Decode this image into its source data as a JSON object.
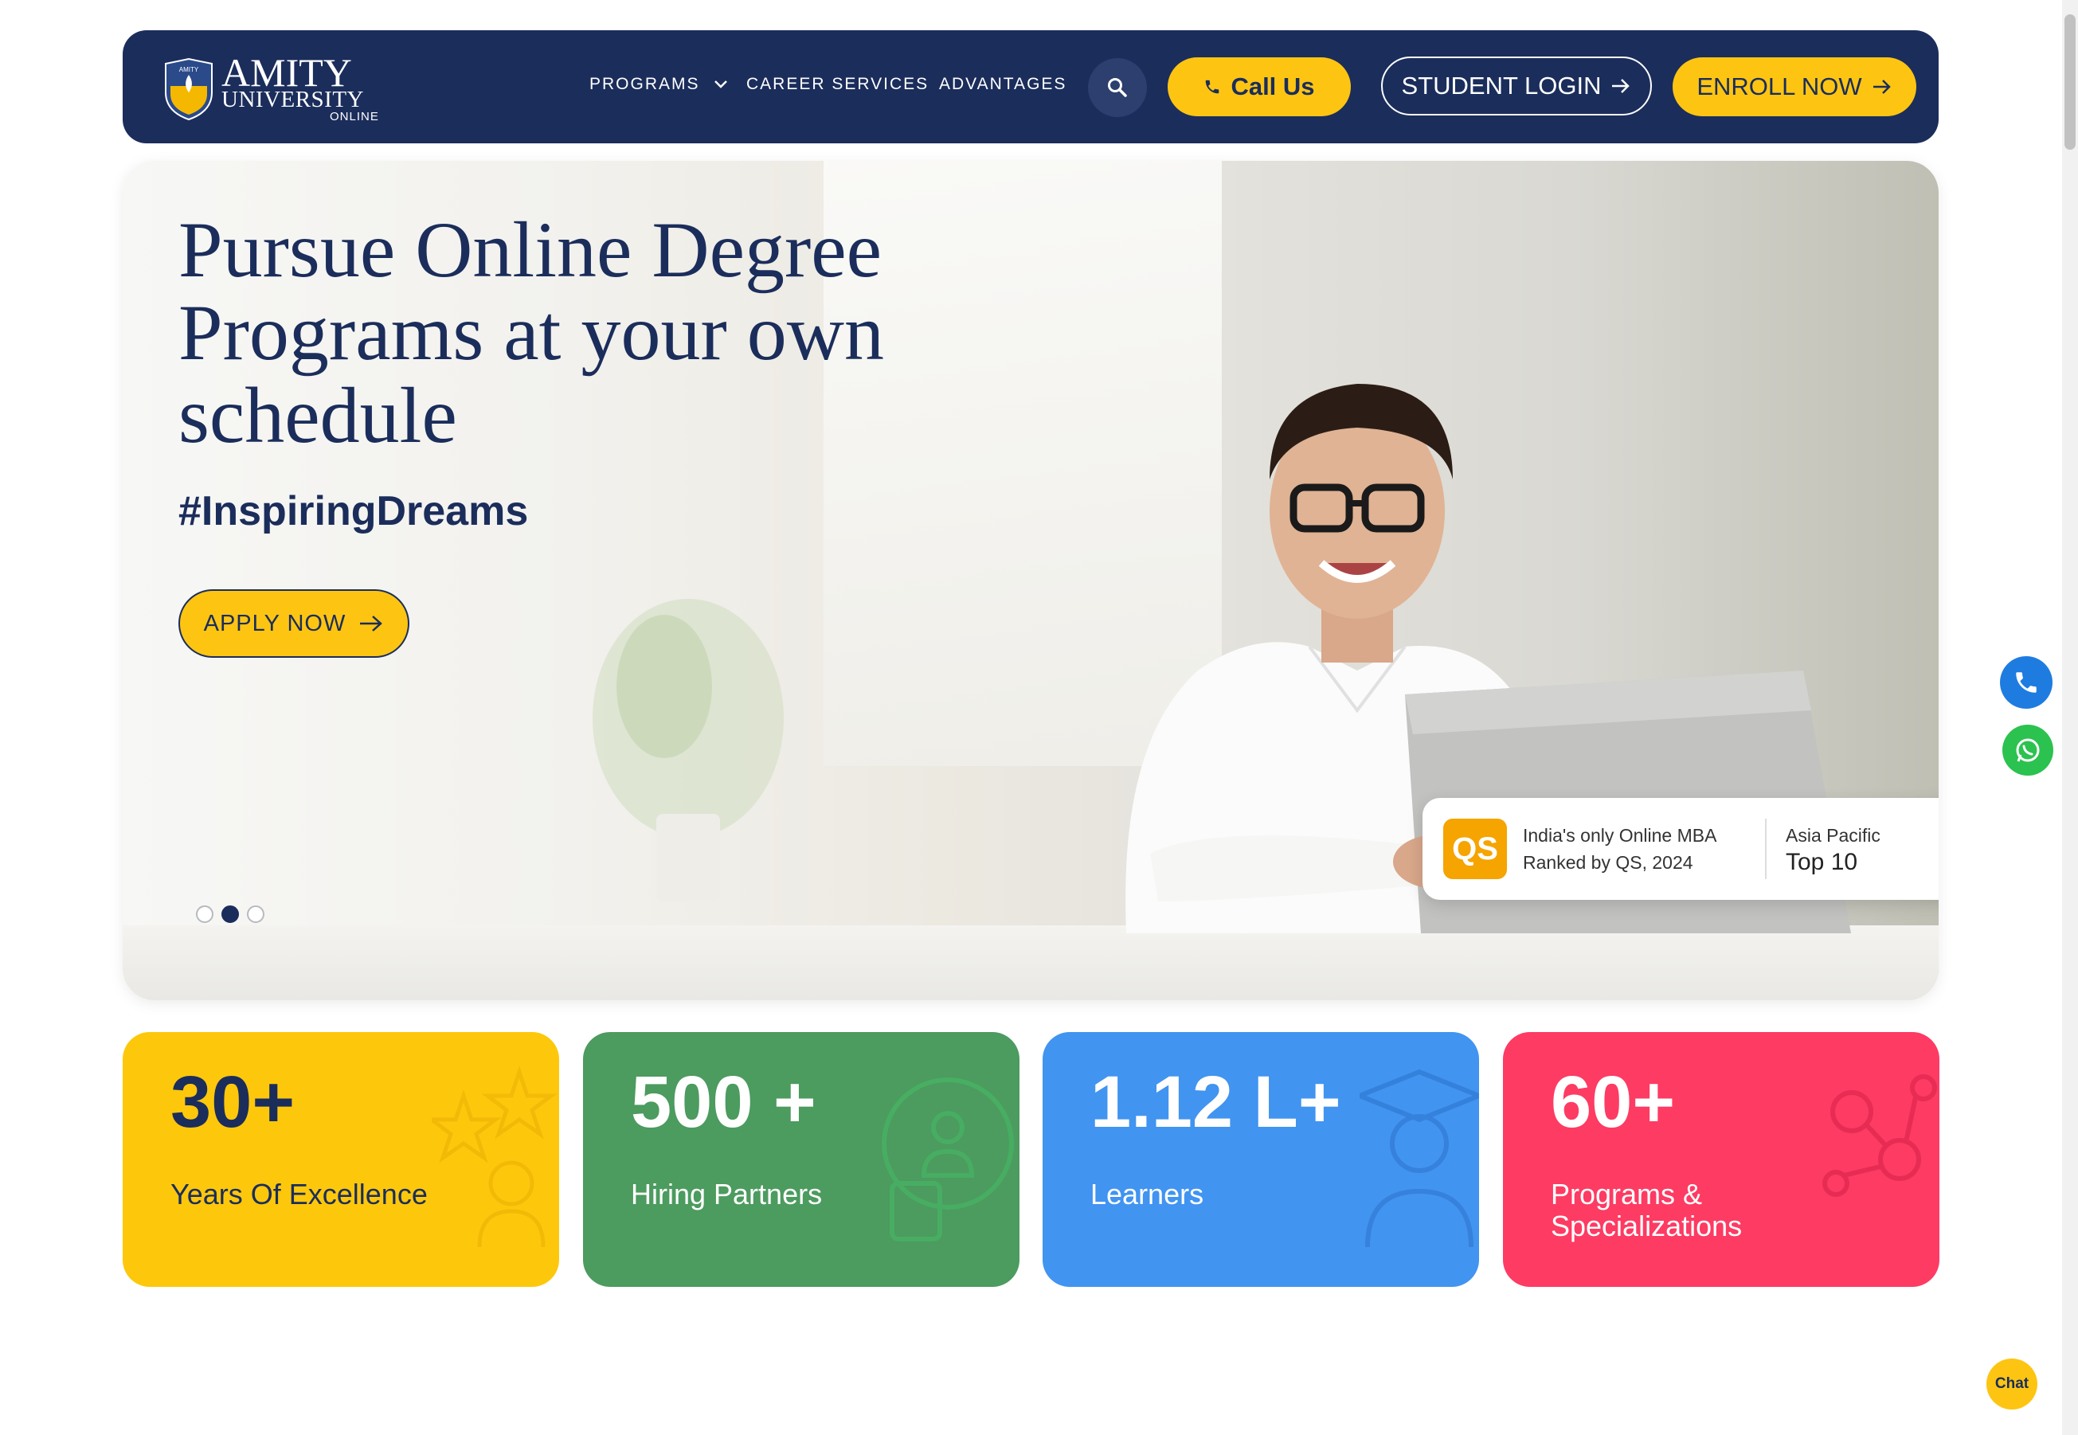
{
  "nav": {
    "logo": {
      "main": "AMITY",
      "sub": "UNIVERSITY",
      "online": "ONLINE"
    },
    "links": {
      "programs": "PROGRAMS",
      "career": "CAREER SERVICES",
      "advantages": "ADVANTAGES"
    },
    "call_label": "Call Us",
    "login_label": "STUDENT LOGIN",
    "enroll_label": "ENROLL NOW"
  },
  "hero": {
    "title": "Pursue Online Degree Programs at your own schedule",
    "tagline": "#InspiringDreams",
    "apply_label": "APPLY NOW",
    "slide_count": 3,
    "active_slide": 2,
    "qs_card": {
      "logo": "QS",
      "line1": "India's only Online MBA",
      "line2": "Ranked by QS, 2024",
      "region": "Asia Pacific",
      "rank": "Top 10"
    }
  },
  "stats": [
    {
      "value": "30+",
      "label": "Years Of Excellence",
      "color": "#fdc80b"
    },
    {
      "value": "500 +",
      "label": "Hiring Partners",
      "color": "#4c9b5f"
    },
    {
      "value": "1.12 L+",
      "label": "Learners",
      "color": "#4194f0"
    },
    {
      "value": "60+",
      "label": "Programs & Specializations",
      "color": "#fd3b63"
    }
  ],
  "chat_label": "Chat",
  "colors": {
    "navy": "#1b2d5b",
    "accent_yellow": "#fdc512"
  }
}
